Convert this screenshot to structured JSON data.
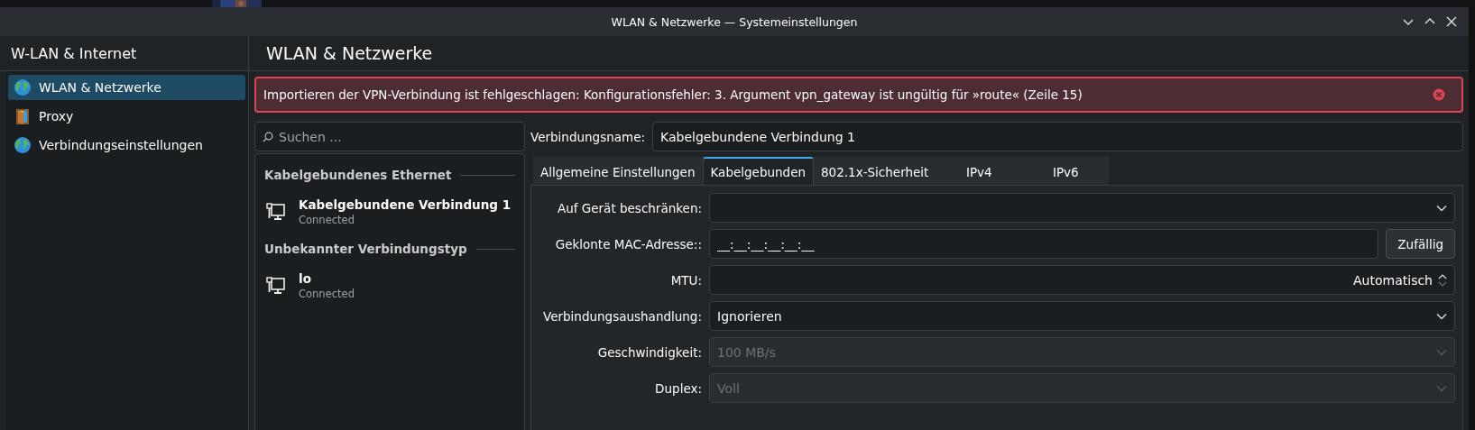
{
  "window": {
    "title": "WLAN & Netzwerke — Systemeinstellungen"
  },
  "sidebar": {
    "title": "W-LAN & Internet",
    "items": [
      {
        "label": "WLAN & Netzwerke",
        "kind": "globe",
        "selected": true
      },
      {
        "label": "Proxy",
        "kind": "door",
        "selected": false
      },
      {
        "label": "Verbindungseinstellungen",
        "kind": "globe",
        "selected": false
      }
    ]
  },
  "page": {
    "title": "WLAN & Netzwerke"
  },
  "error": {
    "message": "Importieren der VPN-Verbindung ist fehlgeschlagen: Konfigurationsfehler: 3. Argument vpn_gateway ist ungültig für »route« (Zeile 15)"
  },
  "search": {
    "placeholder": "Suchen ..."
  },
  "connections": [
    {
      "heading": "Kabelgebundenes Ethernet",
      "items": [
        {
          "name": "Kabelgebundene Verbindung 1",
          "status": "Connected"
        }
      ]
    },
    {
      "heading": "Unbekannter Verbindungstyp",
      "items": [
        {
          "name": "lo",
          "status": "Connected"
        }
      ]
    }
  ],
  "editor": {
    "name_label": "Verbindungsname:",
    "name_value": "Kabelgebundene Verbindung 1",
    "tabs": [
      {
        "label": "Allgemeine Einstellungen",
        "selected": false
      },
      {
        "label": "Kabelgebunden",
        "selected": true
      },
      {
        "label": "802.1x-Sicherheit",
        "selected": false
      },
      {
        "label": "IPv4",
        "selected": false
      },
      {
        "label": "IPv6",
        "selected": false
      }
    ],
    "fields": [
      {
        "label": "Auf Gerät beschränken:",
        "kind": "combo",
        "disabled": false
      },
      {
        "label": "Geklonte MAC-Adresse::",
        "kind": "text",
        "value": "__:__:__:__:__:__",
        "button": "Zufällig",
        "disabled": false
      },
      {
        "label": "MTU:",
        "kind": "spin",
        "value": "Automatisch",
        "disabled": false
      },
      {
        "label": "Verbindungsaushandlung:",
        "kind": "combo",
        "value": "Ignorieren",
        "disabled": false
      },
      {
        "label": "Geschwindigkeit:",
        "kind": "combo",
        "value": "100 MB/s",
        "disabled": true
      },
      {
        "label": "Duplex:",
        "kind": "combo",
        "value": "Voll",
        "disabled": true
      }
    ]
  }
}
